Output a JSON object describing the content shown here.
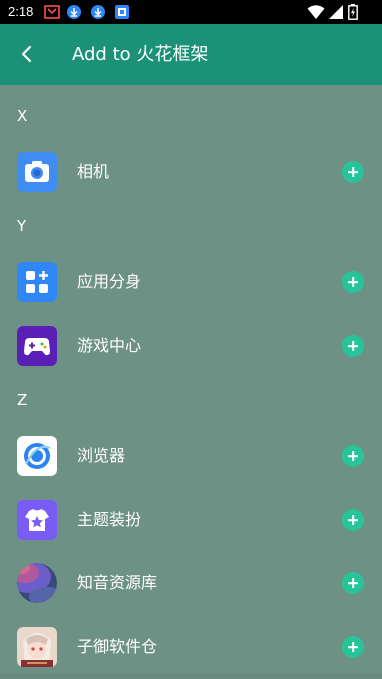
{
  "status_bar": {
    "time": "2:18",
    "icons": [
      "media-icon",
      "download-icon",
      "download-icon",
      "app-notification-icon",
      "wifi-icon",
      "signal-icon",
      "battery-icon"
    ]
  },
  "app_bar": {
    "back_icon": "back-arrow-icon",
    "title": "Add to 火花框架"
  },
  "sections": [
    {
      "letter": "X",
      "apps": [
        {
          "name": "相机",
          "icon": "camera-icon"
        }
      ]
    },
    {
      "letter": "Y",
      "apps": [
        {
          "name": "应用分身",
          "icon": "app-clone-icon"
        },
        {
          "name": "游戏中心",
          "icon": "game-center-icon"
        }
      ]
    },
    {
      "letter": "Z",
      "apps": [
        {
          "name": "浏览器",
          "icon": "browser-icon"
        },
        {
          "name": "主题装扮",
          "icon": "theme-icon"
        },
        {
          "name": "知音资源库",
          "icon": "music-library-icon"
        },
        {
          "name": "子御软件仓",
          "icon": "software-store-icon"
        }
      ]
    }
  ],
  "colors": {
    "app_bar": "#1b9277",
    "background": "#6e9185",
    "add_button": "#27c49a"
  }
}
